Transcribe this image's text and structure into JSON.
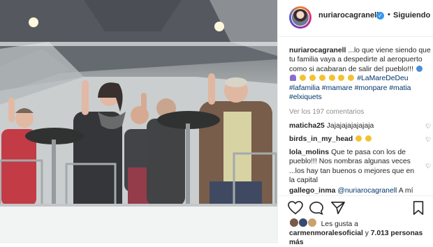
{
  "header": {
    "username": "nuriarocagranell",
    "separator": "•",
    "follow_label": "Siguiendo"
  },
  "caption": {
    "username": "nuriarocagranell",
    "text": "...lo que viene siendo que tu familia vaya a despedirte al aeropuerto como si acabaran de salir del pueblo!!!",
    "hashtags": [
      "#LaMareDeDeu",
      "#lafamilia",
      "#mamare",
      "#monpare",
      "#matia",
      "#elxiquets"
    ]
  },
  "view_comments": "Ver los 197 comentarios",
  "comments": [
    {
      "user": "maticha25",
      "text": "Jajajajajajajaja"
    },
    {
      "user": "birds_in_my_head",
      "text": ""
    },
    {
      "user": "lola_molins",
      "text": "Que te pasa con los de pueblo!!! Nos nombras algunas veces ...los hay tan buenos o mejores que en la capital"
    },
    {
      "user": "gallego_inma",
      "mention": "@nuriarocagranell",
      "text": "A mí"
    }
  ],
  "likes": {
    "prefix": "Les gusta a",
    "user": "carmenmoralesoficial",
    "suffix": "y",
    "count_text": "7.013 personas más"
  },
  "icons": [
    "heart-icon",
    "comment-icon",
    "share-icon",
    "bookmark-icon",
    "verified-icon"
  ],
  "colors": {
    "verified": "#3897f0",
    "hashtag": "#003569",
    "secondary": "#8e8e8e"
  }
}
